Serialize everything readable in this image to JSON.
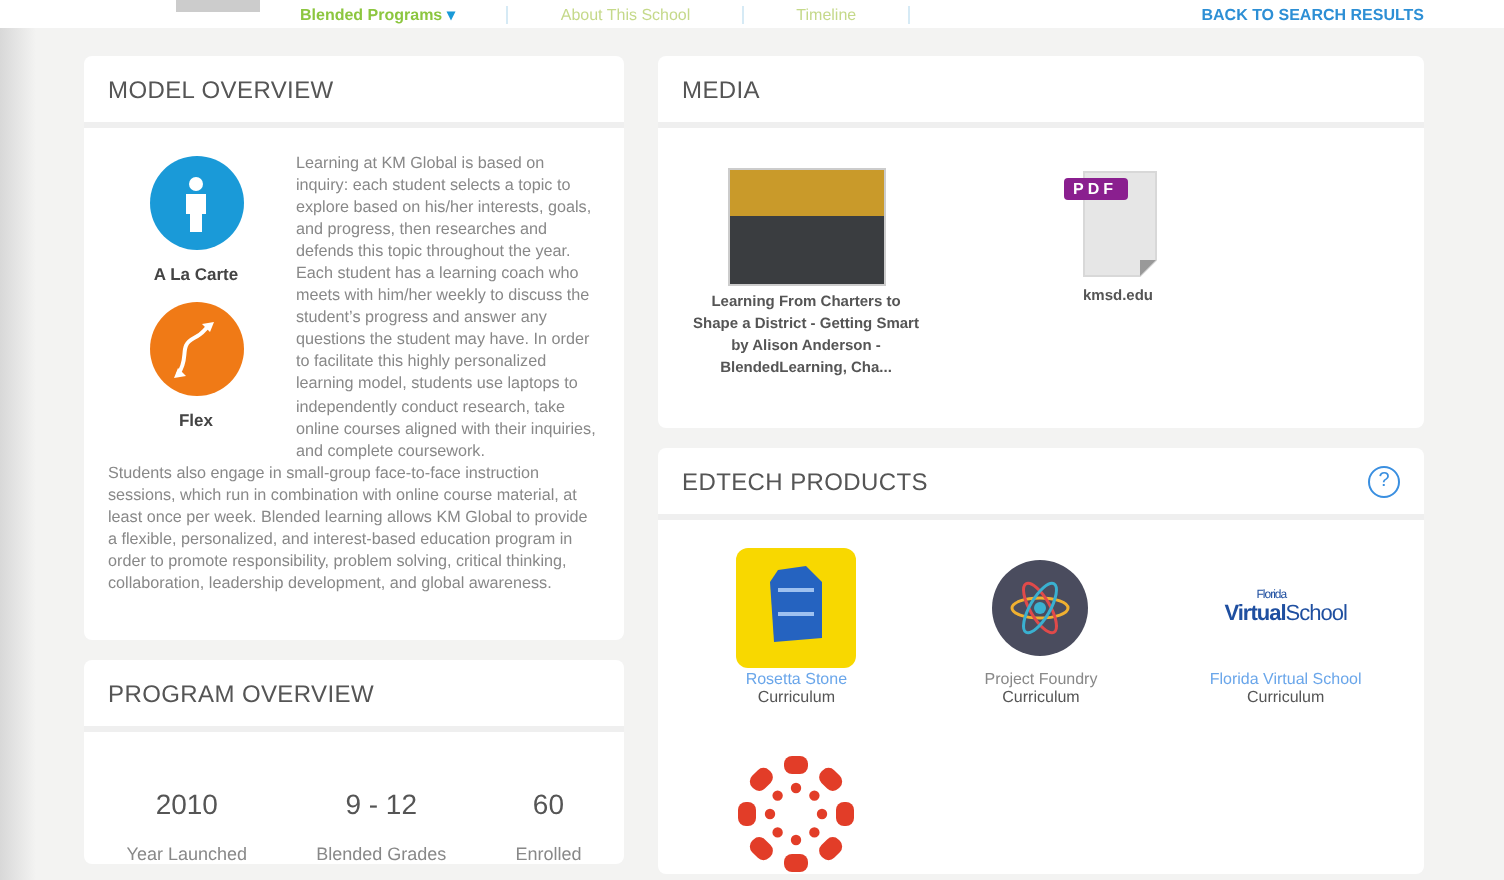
{
  "nav": {
    "items": [
      {
        "label": "Blended Programs",
        "selected": true,
        "caret": "▾"
      },
      {
        "label": "About This School",
        "selected": false
      },
      {
        "label": "Timeline",
        "selected": false
      }
    ],
    "back_link": "BACK TO SEARCH RESULTS"
  },
  "model_overview": {
    "title": "MODEL OVERVIEW",
    "models": [
      {
        "name": "A La Carte",
        "kind": "person",
        "color": "#1a9ad8"
      },
      {
        "name": "Flex",
        "kind": "arrows",
        "color": "#f07a16"
      }
    ],
    "description": [
      "Learning at KM Global is based on inquiry: each student selects a topic to explore based on his/her interests, goals, and progress, then researches and defends this topic throughout the year. Each student has a learning coach who meets with him/her weekly to discuss the student’s progress and answer any questions the student may have. In order to facilitate this highly personalized learning model, students use laptops to independently conduct research, take online courses aligned with their inquiries, and complete coursework.",
      "Students also engage in small-group face-to-face instruction sessions, which run in combination with online course material, at least once per week. Blended learning allows KM Global to provide a flexible, personalized, and interest-based education program in order to promote responsibility, problem solving, critical thinking, collaboration, leadership development, and global awareness."
    ]
  },
  "program_overview": {
    "title": "PROGRAM OVERVIEW",
    "stats": [
      {
        "value": "2010",
        "label": "Year Launched"
      },
      {
        "value": "9 - 12",
        "label": "Blended Grades"
      },
      {
        "value": "60",
        "label": "Enrolled"
      }
    ]
  },
  "media": {
    "title": "MEDIA",
    "items": [
      {
        "kind": "photo",
        "caption": "Learning From Charters to Shape a District - Getting Smart by Alison Anderson - BlendedLearning, Cha..."
      },
      {
        "kind": "pdf",
        "badge": "PDF",
        "caption": "kmsd.edu"
      }
    ]
  },
  "edtech_products": {
    "title": "EDTECH PRODUCTS",
    "help": "?",
    "products": [
      {
        "kind": "stone",
        "name": "Rosetta Stone",
        "category": "Curriculum",
        "linked": true
      },
      {
        "kind": "atom",
        "name": "Project Foundry",
        "category": "Curriculum",
        "linked": false
      },
      {
        "kind": "wordmark",
        "logo_text": [
          "Florida",
          "**Virtual**School"
        ],
        "name": "Florida Virtual School",
        "category": "Curriculum",
        "linked": true
      },
      {
        "kind": "dots"
      }
    ]
  }
}
